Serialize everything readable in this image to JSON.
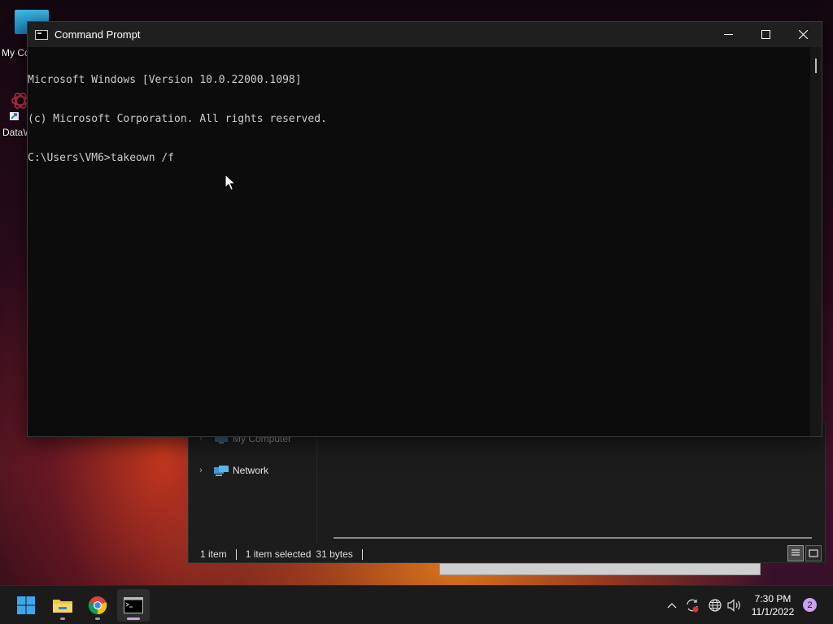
{
  "desktop": {
    "icons": [
      {
        "label": "My Computer",
        "icon": "monitor-icon"
      },
      {
        "label": "DataWatch",
        "icon": "datawatch-app-icon"
      }
    ]
  },
  "cmd": {
    "title": "Command Prompt",
    "icon": "console-icon",
    "lines": [
      "Microsoft Windows [Version 10.0.22000.1098]",
      "(c) Microsoft Corporation. All rights reserved.",
      "C:\\Users\\VM6>takeown /f"
    ]
  },
  "explorer": {
    "nav": [
      {
        "label": "My Computer",
        "icon": "computer-icon"
      },
      {
        "label": "Network",
        "icon": "network-icon"
      }
    ],
    "status": {
      "count": "1 item",
      "selected": "1 item selected",
      "size": "31 bytes"
    }
  },
  "taskbar": {
    "pinned": [
      {
        "name": "Start",
        "icon": "windows-start-icon"
      },
      {
        "name": "File Explorer",
        "icon": "folder-icon"
      },
      {
        "name": "Google Chrome",
        "icon": "chrome-icon"
      },
      {
        "name": "Command Prompt",
        "icon": "console-icon"
      }
    ],
    "clock": {
      "time": "7:30 PM",
      "date": "11/1/2022"
    },
    "notifications": "2"
  },
  "colors": {
    "terminal_bg": "#0c0c0c",
    "terminal_fg": "#cccccc",
    "taskbar_bg": "#1b1b1b",
    "notification_badge": "#c8a2f0"
  }
}
